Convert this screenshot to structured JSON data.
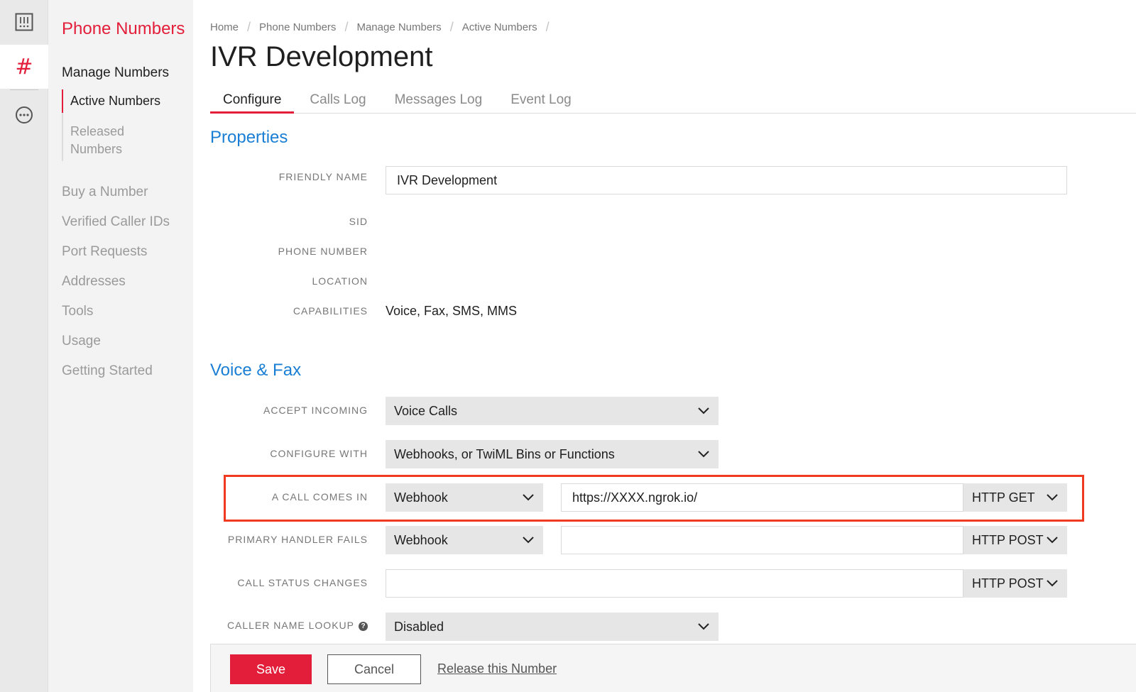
{
  "rail": {
    "icons": [
      "dashboard-icon",
      "hash-icon",
      "more-icon"
    ],
    "hash_glyph": "#"
  },
  "sidebar": {
    "title": "Phone Numbers",
    "group": "Manage Numbers",
    "sub_items": [
      "Active Numbers",
      "Released Numbers"
    ],
    "links": [
      "Buy a Number",
      "Verified Caller IDs",
      "Port Requests",
      "Addresses",
      "Tools",
      "Usage",
      "Getting Started"
    ]
  },
  "breadcrumb": [
    "Home",
    "Phone Numbers",
    "Manage Numbers",
    "Active Numbers"
  ],
  "breadcrumb_sep": "/",
  "page_title": "IVR Development",
  "tabs": [
    "Configure",
    "Calls Log",
    "Messages Log",
    "Event Log"
  ],
  "properties": {
    "heading": "Properties",
    "friendly_name_label": "FRIENDLY NAME",
    "friendly_name_value": "IVR Development",
    "sid_label": "SID",
    "phone_label": "PHONE NUMBER",
    "location_label": "LOCATION",
    "capabilities_label": "CAPABILITIES",
    "capabilities_value": "Voice, Fax, SMS, MMS"
  },
  "voice": {
    "heading": "Voice & Fax",
    "accept_label": "ACCEPT INCOMING",
    "accept_value": "Voice Calls",
    "configure_label": "CONFIGURE WITH",
    "configure_value": "Webhooks, or TwiML Bins or Functions",
    "call_in_label": "A CALL COMES IN",
    "call_in_type": "Webhook",
    "call_in_url": "https://XXXX.ngrok.io/",
    "call_in_method": "HTTP GET",
    "primary_label": "PRIMARY HANDLER FAILS",
    "primary_type": "Webhook",
    "primary_url": "",
    "primary_method": "HTTP POST",
    "status_label": "CALL STATUS CHANGES",
    "status_url": "",
    "status_method": "HTTP POST",
    "lookup_label": "CALLER NAME LOOKUP",
    "lookup_value": "Disabled",
    "help_glyph": "?"
  },
  "footer": {
    "save": "Save",
    "cancel": "Cancel",
    "release": "Release this Number"
  },
  "colors": {
    "accent_red": "#e31e3a",
    "link_blue": "#1a7fd4",
    "highlight": "#f03a1f"
  }
}
